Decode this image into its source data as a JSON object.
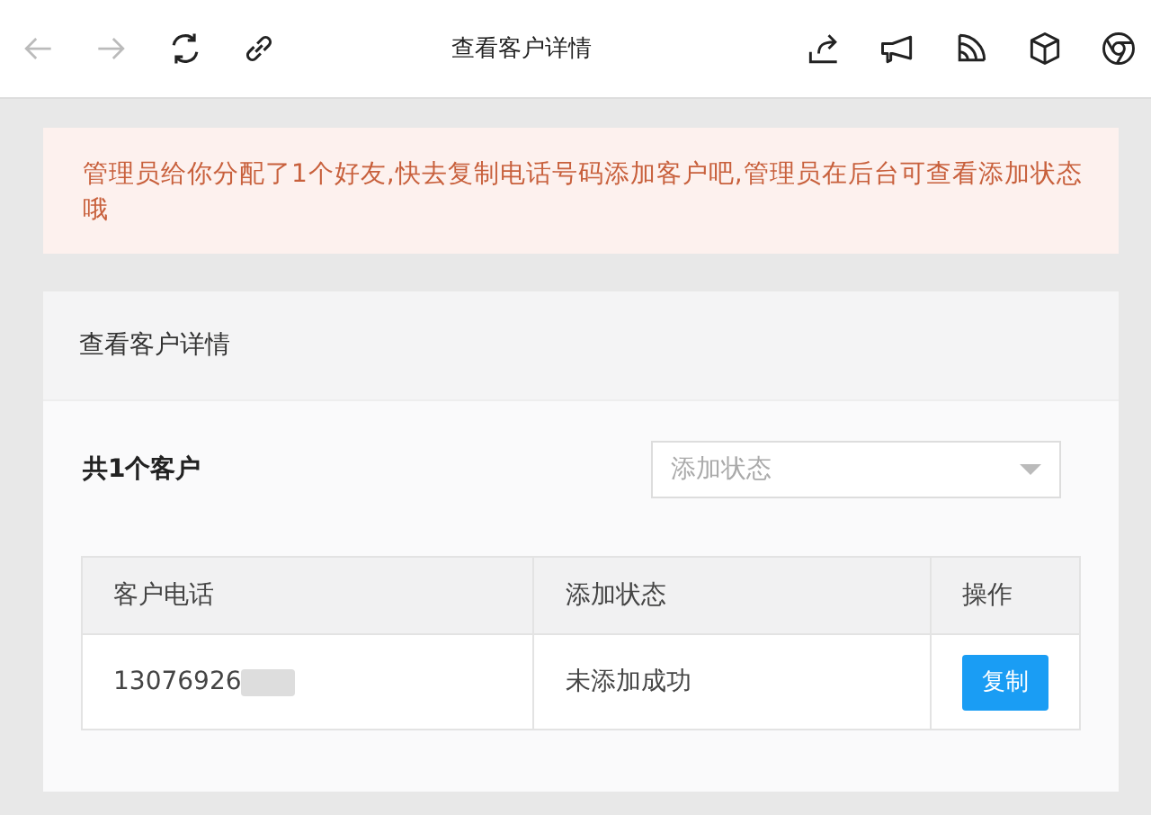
{
  "toolbar": {
    "title": "查看客户详情",
    "left_icons": [
      {
        "kind": "back",
        "disabled": true
      },
      {
        "kind": "forward",
        "disabled": true
      },
      {
        "kind": "refresh",
        "disabled": false
      },
      {
        "kind": "link",
        "disabled": false
      }
    ],
    "right_icons": [
      {
        "kind": "share"
      },
      {
        "kind": "megaphone"
      },
      {
        "kind": "feed"
      },
      {
        "kind": "cube"
      },
      {
        "kind": "browser"
      }
    ]
  },
  "notice": {
    "text": "管理员给你分配了1个好友,快去复制电话号码添加客户吧,管理员在后台可查看添加状态哦"
  },
  "card": {
    "title": "查看客户详情",
    "count": "共1个客户",
    "filter": {
      "placeholder": "添加状态"
    },
    "table": {
      "columns": [
        "客户电话",
        "添加状态",
        "操作"
      ],
      "rows": [
        {
          "phone": "13076926",
          "phone_redacted": true,
          "status": "未添加成功",
          "action": "复制"
        }
      ]
    }
  }
}
